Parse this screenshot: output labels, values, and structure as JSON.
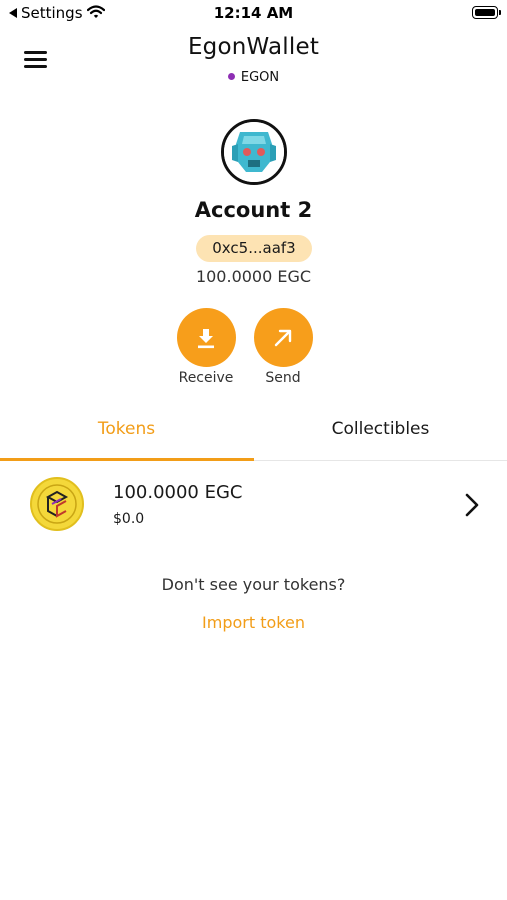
{
  "status_bar": {
    "back_label": "Settings",
    "time": "12:14 AM"
  },
  "header": {
    "title": "EgonWallet",
    "network_name": "EGON",
    "network_color": "#8e2fb4"
  },
  "account": {
    "name": "Account 2",
    "address_short": "0xc5...aaf3",
    "balance": "100.0000 EGC"
  },
  "actions": {
    "receive_label": "Receive",
    "send_label": "Send",
    "accent_color": "#f79e1b"
  },
  "tabs": [
    {
      "label": "Tokens",
      "active": true
    },
    {
      "label": "Collectibles",
      "active": false
    }
  ],
  "tokens": [
    {
      "amount": "100.0000 EGC",
      "fiat_value": "$0.0",
      "icon": "egon-coin-icon"
    }
  ],
  "empty_prompt": {
    "text": "Don't see your tokens?",
    "link_label": "Import token"
  }
}
